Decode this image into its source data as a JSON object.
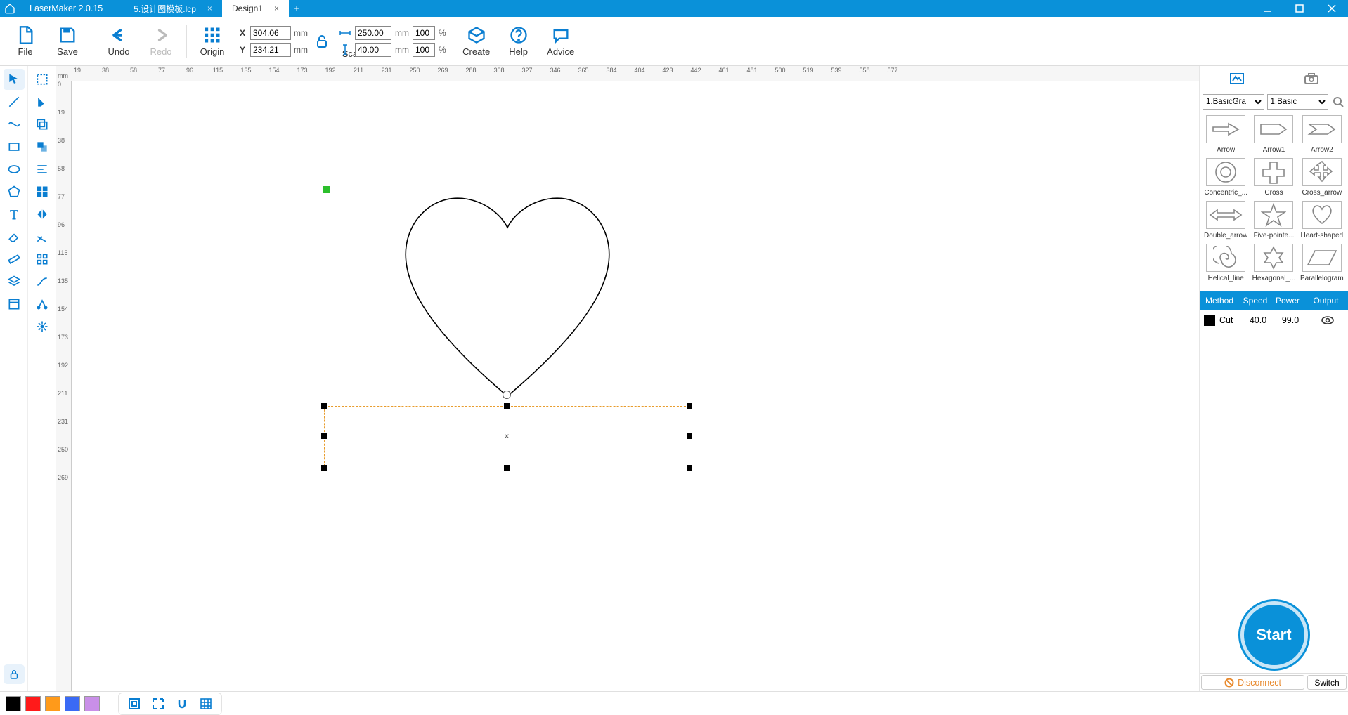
{
  "titlebar": {
    "app_name": "LaserMaker 2.0.15",
    "tabs": [
      {
        "label": "5.设计图模板.lcp",
        "active": false,
        "closable": true
      },
      {
        "label": "Design1",
        "active": true,
        "closable": true
      }
    ]
  },
  "toolbar": {
    "file": "File",
    "save": "Save",
    "undo": "Undo",
    "redo": "Redo",
    "origin": "Origin",
    "scale": "Scale",
    "create": "Create",
    "help": "Help",
    "advice": "Advice",
    "x_val": "304.06",
    "y_val": "234.21",
    "unit_mm": "mm",
    "w_val": "250.00",
    "h_val": "40.00",
    "w_pct": "100",
    "h_pct": "100",
    "unit_pct": "%"
  },
  "ruler": {
    "unit": "mm",
    "h_labels": [
      "19",
      "38",
      "58",
      "77",
      "96",
      "115",
      "135",
      "154",
      "173",
      "192",
      "211",
      "231",
      "250",
      "269",
      "288",
      "308",
      "327",
      "346",
      "365",
      "384",
      "404",
      "423",
      "442",
      "461",
      "481",
      "500",
      "519",
      "539",
      "558",
      "577"
    ],
    "v_labels": [
      "0",
      "19",
      "38",
      "58",
      "77",
      "96",
      "115",
      "135",
      "154",
      "173",
      "192",
      "211",
      "231",
      "250",
      "269"
    ]
  },
  "right": {
    "select1": "1.BasicGra",
    "select2": "1.Basic",
    "shapes": [
      {
        "name": "Arrow"
      },
      {
        "name": "Arrow1"
      },
      {
        "name": "Arrow2"
      },
      {
        "name": "Concentric_..."
      },
      {
        "name": "Cross"
      },
      {
        "name": "Cross_arrow"
      },
      {
        "name": "Double_arrow"
      },
      {
        "name": "Five-pointe..."
      },
      {
        "name": "Heart-shaped"
      },
      {
        "name": "Helical_line"
      },
      {
        "name": "Hexagonal_..."
      },
      {
        "name": "Parallelogram"
      }
    ],
    "layer_headers": {
      "method": "Method",
      "speed": "Speed",
      "power": "Power",
      "output": "Output"
    },
    "layer_row": {
      "method": "Cut",
      "speed": "40.0",
      "power": "99.0"
    },
    "start_label": "Start",
    "disconnect_label": "Disconnect",
    "switch_label": "Switch"
  },
  "bottom": {
    "colors": [
      "#000000",
      "#ff1a1a",
      "#ff9a1a",
      "#3a6af5",
      "#c98fe8"
    ]
  }
}
